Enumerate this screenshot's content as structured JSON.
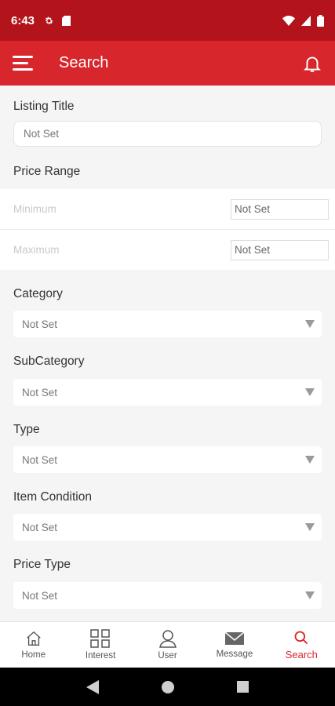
{
  "status_bar": {
    "time": "6:43"
  },
  "app_bar": {
    "title": "Search"
  },
  "form": {
    "listing_title": {
      "label": "Listing Title",
      "value": "Not Set"
    },
    "price_range": {
      "label": "Price Range",
      "minimum_label": "Minimum",
      "minimum_value": "Not Set",
      "maximum_label": "Maximum",
      "maximum_value": "Not Set"
    },
    "category": {
      "label": "Category",
      "value": "Not Set"
    },
    "subcategory": {
      "label": "SubCategory",
      "value": "Not Set"
    },
    "type": {
      "label": "Type",
      "value": "Not Set"
    },
    "item_condition": {
      "label": "Item Condition",
      "value": "Not Set"
    },
    "price_type": {
      "label": "Price Type",
      "value": "Not Set"
    }
  },
  "bottom_nav": {
    "items": [
      {
        "label": "Home",
        "icon": "home-icon"
      },
      {
        "label": "Interest",
        "icon": "grid-icon"
      },
      {
        "label": "User",
        "icon": "user-icon"
      },
      {
        "label": "Message",
        "icon": "mail-icon"
      },
      {
        "label": "Search",
        "icon": "search-icon",
        "active": true
      }
    ]
  },
  "colors": {
    "status_bar": "#b3141b",
    "app_bar": "#d7262c",
    "accent": "#d7262c"
  }
}
